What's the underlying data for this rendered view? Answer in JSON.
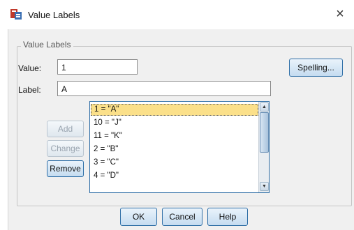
{
  "window": {
    "title": "Value Labels",
    "close_glyph": "×",
    "app_icon": "spss-dialog-icon"
  },
  "group": {
    "legend": "Value Labels"
  },
  "value_field": {
    "label": "Value:",
    "value": "1"
  },
  "label_field": {
    "label": "Label:",
    "value": "A"
  },
  "buttons": {
    "spelling": "Spelling...",
    "add": "Add",
    "change": "Change",
    "remove": "Remove",
    "ok": "OK",
    "cancel": "Cancel",
    "help": "Help"
  },
  "list": {
    "items": [
      "1 = \"A\"",
      "10 = \"J\"",
      "11 = \"K\"",
      "2 = \"B\"",
      "3 = \"C\"",
      "4 = \"D\""
    ],
    "selected_index": 0
  }
}
